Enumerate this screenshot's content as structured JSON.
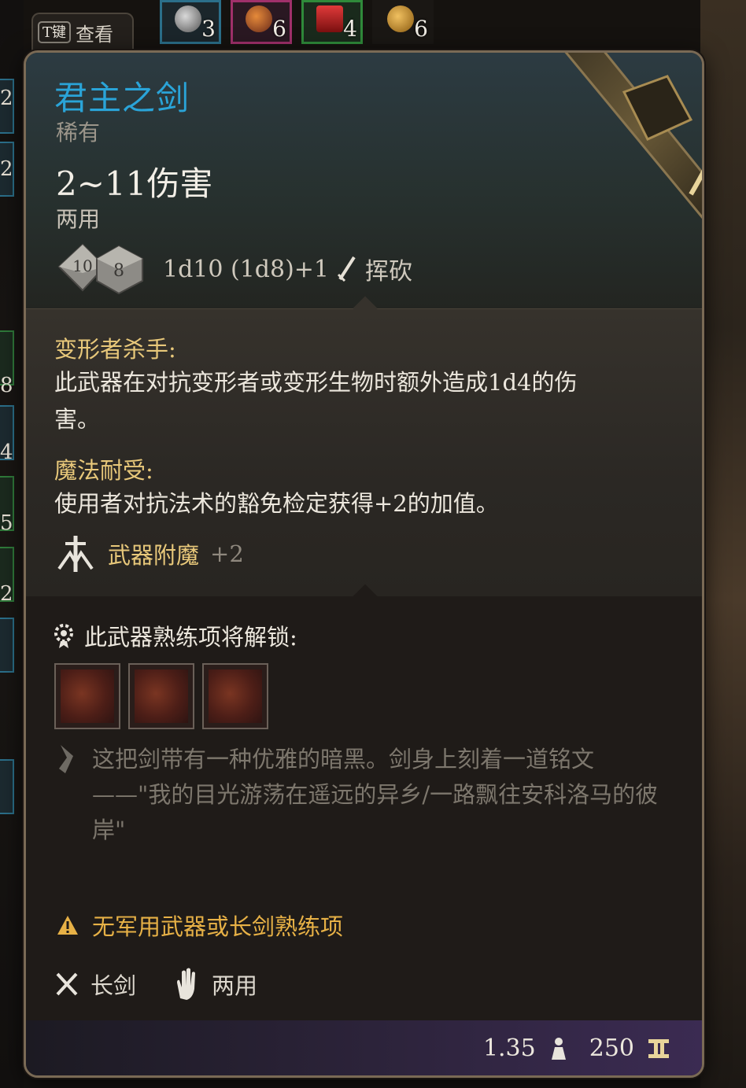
{
  "hud": {
    "look_key": "T键",
    "look_label": "查看",
    "quick_slots": [
      {
        "icon": "potion-flask-icon",
        "count": "3"
      },
      {
        "icon": "elixir-bottle-icon",
        "count": "6"
      },
      {
        "icon": "red-vial-icon",
        "count": "4"
      },
      {
        "icon": "grenade-icon",
        "count": "6"
      }
    ],
    "left_counts": [
      "2",
      "2",
      "8",
      "4",
      "5",
      "2"
    ]
  },
  "item": {
    "name": "君主之剑",
    "rarity": "稀有",
    "damage": "2~11伤害",
    "handedness": "两用",
    "dice": [
      "10",
      "8"
    ],
    "dice_formula": "1d10 (1d8)+1",
    "damage_type": "挥砍",
    "properties": [
      {
        "name": "变形者杀手:",
        "desc": "此武器在对抗变形者或变形生物时额外造成1d4的伤害。"
      },
      {
        "name": "魔法耐受:",
        "desc": "使用者对抗法术的豁免检定获得+2的加值。"
      }
    ],
    "enchantment": {
      "name": "武器附魔",
      "value": "+2"
    },
    "proficiency_unlock": "此武器熟练项将解锁:",
    "skills": [
      "pommel-strike-icon",
      "flourish-icon",
      "lacerate-icon"
    ],
    "lore": "这把剑带有一种优雅的暗黑。剑身上刻着一道铭文——\"我的目光游荡在遥远的异乡/一路飘往安科洛马的彼岸\"",
    "warning": "无军用武器或长剑熟练项",
    "weapon_type": "长剑",
    "grip": "两用",
    "weight": "1.35",
    "value": "250"
  },
  "colors": {
    "title": "#2aa4d8",
    "property": "#e8c87a",
    "warning": "#e7b146",
    "lore": "#7d776d"
  }
}
